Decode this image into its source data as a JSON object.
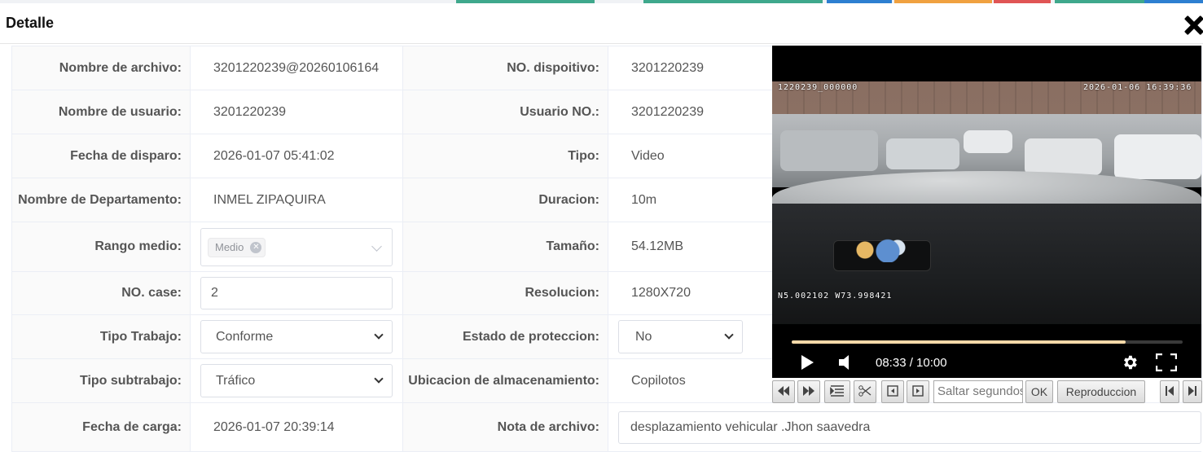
{
  "modal": {
    "title": "Detalle"
  },
  "rows": [
    {
      "l1": "Nombre de archivo:",
      "v1": "3201220239@20260106164",
      "l2": "NO. dispoitivo:",
      "v2": "3201220239"
    },
    {
      "l1": "Nombre de usuario:",
      "v1": "3201220239",
      "l2": "Usuario NO.:",
      "v2": "3201220239"
    },
    {
      "l1": "Fecha de disparo:",
      "v1": "2026-01-07 05:41:02",
      "l2": "Tipo:",
      "v2": "Video"
    },
    {
      "l1": "Nombre de Departamento:",
      "v1": "INMEL ZIPAQUIRA",
      "l2": "Duracion:",
      "v2": "10m"
    },
    {
      "l1": "Rango medio:",
      "v1": "Medio",
      "l2": "Tamaño:",
      "v2": "54.12MB"
    },
    {
      "l1": "NO. case:",
      "v1": "2",
      "l2": "Resolucion:",
      "v2": "1280X720"
    },
    {
      "l1": "Tipo Trabajo:",
      "v1": "Conforme",
      "l2": "Estado de proteccion:",
      "v2": "No"
    },
    {
      "l1": "Tipo subtrabajo:",
      "v1": "Tráfico",
      "l2": "Ubicacion de almacenamiento:",
      "v2": "Copilotos"
    },
    {
      "l1": "Fecha de carga:",
      "v1": "2026-01-07 20:39:14",
      "l2": "Nota de archivo:",
      "v2": "desplazamiento vehicular .Jhon saavedra"
    }
  ],
  "player": {
    "osd_id": "1220239_000000",
    "osd_datetime": "2026-01-06  16:39:36",
    "osd_gps": "N5.002102  W73.998421",
    "time": "08:33 / 10:00",
    "progress": 0.855
  },
  "toolbar": {
    "seek_placeholder": "Saltar segundos",
    "ok_label": "OK",
    "playback_label": "Reproduccion"
  },
  "colors": {
    "progress_fill": "#f4d9a8",
    "label_bg": "#fafafa",
    "border": "#ebeef5"
  }
}
